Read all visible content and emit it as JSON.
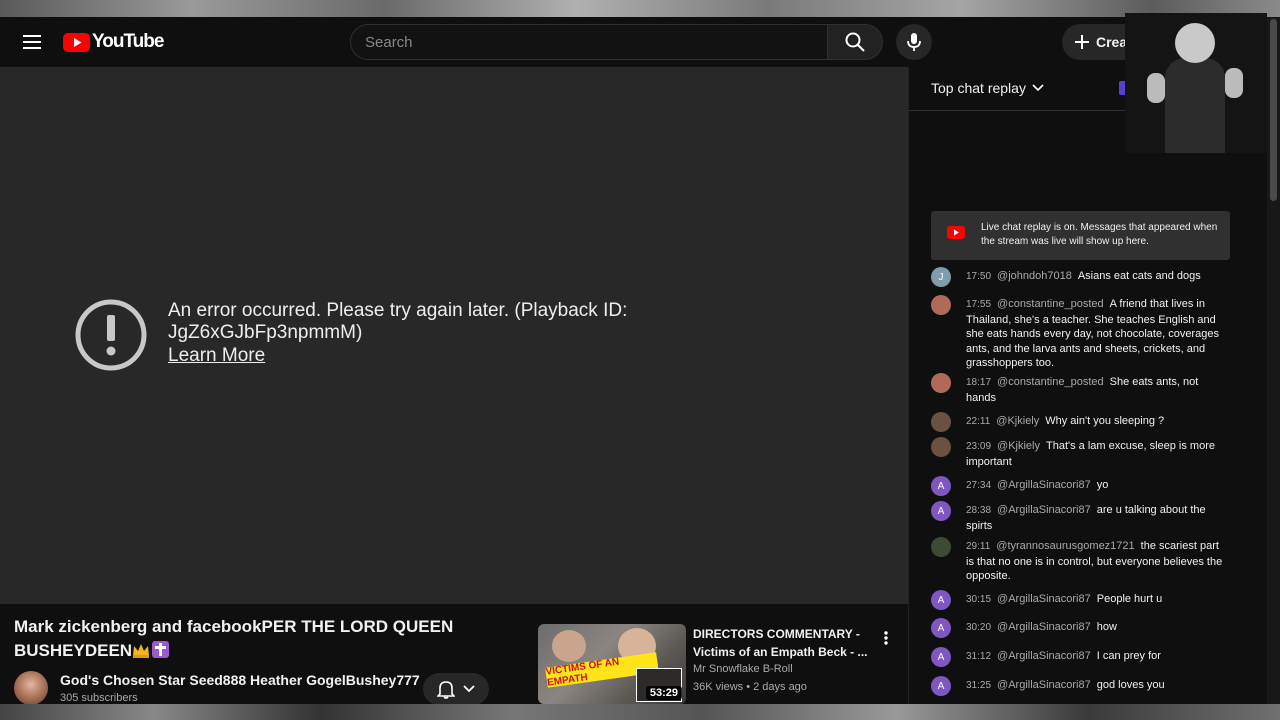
{
  "masthead": {
    "logo_text": "YouTube",
    "search_placeholder": "Search",
    "create_label": "Creat"
  },
  "player": {
    "error_message": "An error occurred. Please try again later. (Playback ID: JgZ6xGJbFp3npmmM)",
    "learn_more": "Learn More"
  },
  "video": {
    "title": "Mark zickenberg and facebookPER THE LORD QUEEN BUSHEYDEEN",
    "title_emoji": "crown-icon",
    "channel_name": "God's Chosen Star Seed888 Heather GogelBushey777",
    "subscribers": "305 subscribers"
  },
  "recommendation": {
    "title": "DIRECTORS COMMENTARY - Victims of an Empath Beck - ...",
    "channel": "Mr Snowflake B-Roll",
    "meta": "36K views • 2 days ago",
    "duration": "53:29",
    "thumb_text": "VICTIMS OF AN EMPATH"
  },
  "chat": {
    "mode_label": "Top chat replay",
    "banner_text": "Live chat replay is on. Messages that appeared when the stream was live will show up here.",
    "messages": [
      {
        "time": "17:50",
        "author": "@johndoh7018",
        "text": "Asians eat cats and dogs",
        "avatar": "J",
        "avatar_color": "#7f9caa"
      },
      {
        "time": "17:55",
        "author": "@constantine_posted",
        "text": "A friend that lives in Thailand, she's a teacher. She teaches English and she eats hands every day, not chocolate, coverages ants, and the larva ants and sheets, crickets, and grasshoppers too.",
        "avatar": "",
        "avatar_color": "#b06a5a"
      },
      {
        "time": "18:17",
        "author": "@constantine_posted",
        "text": "She eats ants, not hands",
        "avatar": "",
        "avatar_color": "#b06a5a"
      },
      {
        "time": "22:11",
        "author": "@Kjkiely",
        "text": "Why ain't you sleeping ?",
        "avatar": "",
        "avatar_color": "#6b5142"
      },
      {
        "time": "23:09",
        "author": "@Kjkiely",
        "text": "That's a lam excuse, sleep is more important",
        "avatar": "",
        "avatar_color": "#6b5142"
      },
      {
        "time": "27:34",
        "author": "@ArgillaSinacori87",
        "text": "yo",
        "avatar": "A",
        "avatar_color": "#7e57c2"
      },
      {
        "time": "28:38",
        "author": "@ArgillaSinacori87",
        "text": "are u talking about the spirts",
        "avatar": "A",
        "avatar_color": "#7e57c2"
      },
      {
        "time": "29:11",
        "author": "@tyrannosaurusgomez1721",
        "text": "the scariest part is that no one is in control, but everyone believes the opposite.",
        "avatar": "",
        "avatar_color": "#3d4a35"
      },
      {
        "time": "30:15",
        "author": "@ArgillaSinacori87",
        "text": "People hurt u",
        "avatar": "A",
        "avatar_color": "#7e57c2"
      },
      {
        "time": "30:20",
        "author": "@ArgillaSinacori87",
        "text": "how",
        "avatar": "A",
        "avatar_color": "#7e57c2"
      },
      {
        "time": "31:12",
        "author": "@ArgillaSinacori87",
        "text": "I can prey for",
        "avatar": "A",
        "avatar_color": "#7e57c2"
      },
      {
        "time": "31:25",
        "author": "@ArgillaSinacori87",
        "text": "god loves you",
        "avatar": "A",
        "avatar_color": "#7e57c2"
      }
    ]
  }
}
